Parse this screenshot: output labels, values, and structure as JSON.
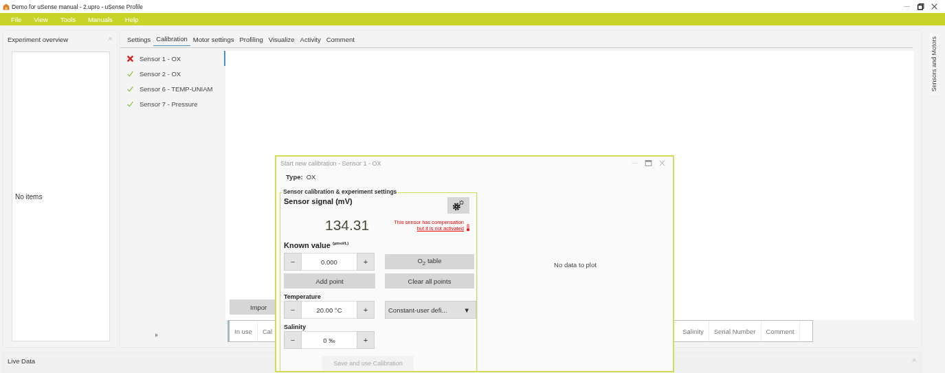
{
  "window": {
    "title": "Demo for uSense manual - 2.upro - uSense Profile"
  },
  "menu": [
    "File",
    "View",
    "Tools",
    "Manuals",
    "Help"
  ],
  "experiment_overview": {
    "title": "Experiment overview",
    "empty_text": "No items"
  },
  "tabs": [
    {
      "label": "Settings",
      "selected": false
    },
    {
      "label": "Calibration",
      "selected": true
    },
    {
      "label": "Motor settings",
      "selected": false
    },
    {
      "label": "Profiling",
      "selected": false
    },
    {
      "label": "Visualize",
      "selected": false
    },
    {
      "label": "Activity",
      "selected": false
    },
    {
      "label": "Comment",
      "selected": false
    }
  ],
  "sensors": [
    {
      "name": "Sensor 1 - OX",
      "calibrated": false,
      "selected": true
    },
    {
      "name": "Sensor 2 - OX",
      "calibrated": true,
      "selected": false
    },
    {
      "name": "Sensor 6 - TEMP-UNIAM",
      "calibrated": true,
      "selected": false
    },
    {
      "name": "Sensor 7 - Pressure",
      "calibrated": true,
      "selected": false
    }
  ],
  "import_button": "Impor",
  "table": {
    "columns_left": [
      "In use",
      "Cal"
    ],
    "columns_right": [
      "Salinity",
      "Serial Number",
      "Comment"
    ]
  },
  "side_tab": "Sensors and Motors",
  "live_data": {
    "title": "Live Data"
  },
  "dialog": {
    "title": "Start new calibration - Sensor 1 - OX",
    "type_label": "Type:",
    "type_value": "OX",
    "group_title": "Sensor calibration & experiment settings",
    "signal_label": "Sensor signal (mV)",
    "signal_value": "134.31",
    "warning": [
      "This sensor has compensation",
      "but it is not activated"
    ],
    "known_label": "Known value $^{(µmol/L)}$",
    "known_value": {
      "minus": "−",
      "value": "0.000",
      "plus": "+"
    },
    "o2_table_button": "O$_{2}$ table",
    "add_point_button": "Add point",
    "clear_points_button": "Clear all points",
    "temperature_label": "Temperature",
    "temperature": {
      "minus": "−",
      "value": "20.00 °C",
      "plus": "+"
    },
    "temperature_mode": {
      "value": "Constant-user defi...",
      "arrow": "▼"
    },
    "salinity_label": "Salinity",
    "salinity": {
      "minus": "−",
      "value": "0 ‰",
      "plus": "+"
    },
    "save_button": {
      "label": "Save and use Calibration",
      "disabled": true
    },
    "plot_message": "No data to plot"
  }
}
